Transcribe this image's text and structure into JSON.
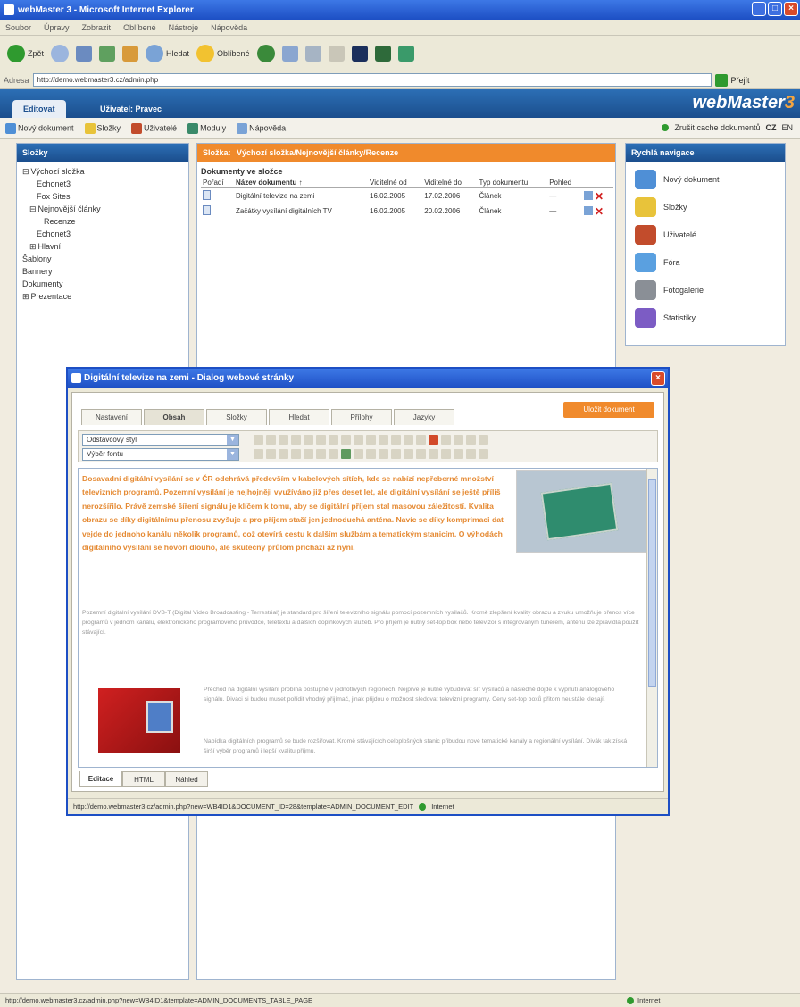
{
  "window": {
    "title": "webMaster 3 - Microsoft Internet Explorer"
  },
  "menu": [
    "Soubor",
    "Úpravy",
    "Zobrazit",
    "Oblíbené",
    "Nástroje",
    "Nápověda"
  ],
  "toolbar": {
    "back": "Zpět",
    "search": "Hledat",
    "favorites": "Oblíbené"
  },
  "address": {
    "label": "Adresa",
    "url": "http://demo.webmaster3.cz/admin.php",
    "go": "Přejít"
  },
  "app": {
    "tab_main": "Editovat",
    "tab_user": "Uživatel: Pravec",
    "brand_text": "webMaster",
    "brand_num": "3"
  },
  "apptoolbar": {
    "items": [
      "Nový dokument",
      "Složky",
      "Uživatelé",
      "Moduly",
      "Nápověda"
    ],
    "right": "Zrušit cache dokumentů",
    "lang1": "CZ",
    "lang2": "EN"
  },
  "tree": {
    "title": "Složky",
    "items": [
      {
        "label": "Výchozí složka",
        "indent": 0,
        "prefix": "⊟"
      },
      {
        "label": "Echonet3",
        "indent": 2,
        "prefix": ""
      },
      {
        "label": "Fox Sites",
        "indent": 2,
        "prefix": ""
      },
      {
        "label": "Nejnovější články",
        "indent": 1,
        "prefix": "⊟"
      },
      {
        "label": "Recenze",
        "indent": 3,
        "prefix": ""
      },
      {
        "label": "Echonet3",
        "indent": 2,
        "prefix": ""
      },
      {
        "label": "Hlavní",
        "indent": 1,
        "prefix": "⊞"
      },
      {
        "label": "Šablony",
        "indent": 0,
        "prefix": ""
      },
      {
        "label": "Bannery",
        "indent": 0,
        "prefix": ""
      },
      {
        "label": "Dokumenty",
        "indent": 0,
        "prefix": ""
      },
      {
        "label": "Prezentace",
        "indent": 0,
        "prefix": "⊞"
      }
    ]
  },
  "main": {
    "header_prefix": "Složka:",
    "header_title": "Výchozí složka/Nejnovější články/Recenze",
    "subtitle": "Dokumenty ve složce",
    "columns": [
      "Pořadí",
      "Název dokumentu ↑",
      "Viditelné od",
      "Viditelné do",
      "Typ dokumentu",
      "Pohled"
    ],
    "rows": [
      {
        "name": "Digitální televize na zemi",
        "from": "16.02.2005",
        "to": "17.02.2006",
        "type": "Článek",
        "view": "—"
      },
      {
        "name": "Začátky vysílání digitálních TV",
        "from": "16.02.2005",
        "to": "20.02.2006",
        "type": "Článek",
        "view": "—"
      }
    ]
  },
  "quick": {
    "title": "Rychlá navigace",
    "items": [
      {
        "label": "Nový dokument",
        "color": "#4f8fd6",
        "icon": "new-document-icon"
      },
      {
        "label": "Složky",
        "color": "#e8c33a",
        "icon": "folder-icon"
      },
      {
        "label": "Uživatelé",
        "color": "#c24c2c",
        "icon": "users-icon"
      },
      {
        "label": "Fóra",
        "color": "#5aa0e0",
        "icon": "forum-icon"
      },
      {
        "label": "Fotogalerie",
        "color": "#8a8f96",
        "icon": "camera-icon"
      },
      {
        "label": "Statistiky",
        "color": "#7c5cc4",
        "icon": "chart-icon"
      }
    ]
  },
  "dialog": {
    "title": "Digitální televize na zemi - Dialog webové stránky",
    "save": "Uložit dokument",
    "tabs": [
      "Nastavení",
      "Obsah",
      "Složky",
      "Hledat",
      "Přílohy",
      "Jazyky"
    ],
    "style_select": "Odstavcový styl",
    "font_select": "Výběr fontu",
    "intro_text": "Dosavadní digitální vysílání se v ČR odehrává především v kabelových sítích, kde se nabízí nepřeberné množství televizních programů. Pozemní vysílání je nejhojněji využíváno již přes deset let, ale digitální vysílání se ještě příliš nerozšířilo. Právě zemské šíření signálu je klíčem k tomu, aby se digitální příjem stal masovou záležitostí. Kvalita obrazu se díky digitálnímu přenosu zvyšuje a pro příjem stačí jen jednoduchá anténa. Navíc se díky komprimaci dat vejde do jednoho kanálu několik programů, což otevírá cestu k dalším službám a tematickým stanicím. O výhodách digitálního vysílání se hovoří dlouho, ale skutečný průlom přichází až nyní.",
    "gray_text1": "Pozemní digitální vysílání DVB-T (Digital Video Broadcasting - Terrestrial) je standard pro šíření televizního signálu pomocí pozemních vysílačů. Kromě zlepšení kvality obrazu a zvuku umožňuje přenos více programů v jednom kanálu, elektronického programového průvodce, teletextu a dalších doplňkových služeb. Pro příjem je nutný set-top box nebo televizor s integrovaným tunerem, anténu lze zpravidla použít stávající.",
    "gray_text2": "Přechod na digitální vysílání probíhá postupně v jednotlivých regionech. Nejprve je nutné vybudovat síť vysílačů a následně dojde k vypnutí analogového signálu. Diváci si budou muset pořídit vhodný přijímač, jinak přijdou o možnost sledovat televizní programy. Ceny set-top boxů přitom neustále klesají.",
    "gray_text3": "Nabídka digitálních programů se bude rozšiřovat. Kromě stávajících celoplošných stanic přibudou nové tematické kanály a regionální vysílání. Divák tak získá širší výběr programů i lepší kvalitu příjmu.",
    "modes": [
      "Editace",
      "HTML",
      "Náhled"
    ],
    "status_url": "http://demo.webmaster3.cz/admin.php?new=WB4ID1&DOCUMENT_ID=28&template=ADMIN_DOCUMENT_EDIT",
    "status_zone": "Internet"
  },
  "statusbar": {
    "url": "http://demo.webmaster3.cz/admin.php?new=WB4ID1&template=ADMIN_DOCUMENTS_TABLE_PAGE",
    "zone": "Internet"
  }
}
